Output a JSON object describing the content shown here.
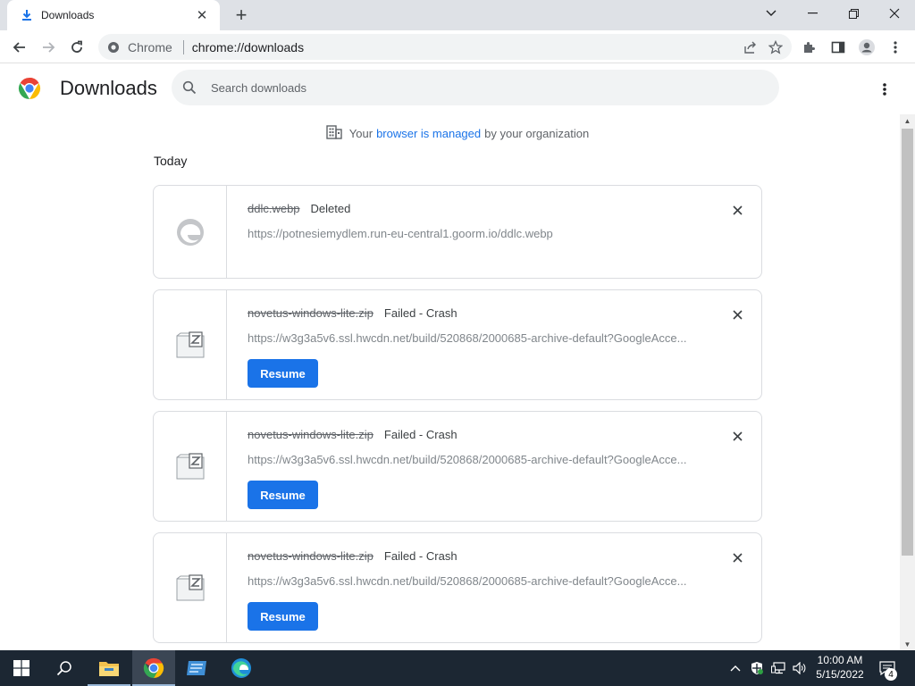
{
  "tab": {
    "title": "Downloads",
    "close": "✕"
  },
  "newtab": "+",
  "window_controls": {
    "chevron": "⌄",
    "minimize": "—",
    "maximize": "❐",
    "close": "✕"
  },
  "omnibox": {
    "site": "Chrome",
    "url": "chrome://downloads"
  },
  "page": {
    "title": "Downloads",
    "search_placeholder": "Search downloads",
    "managed_prefix": "Your",
    "managed_link": "browser is managed",
    "managed_suffix": "by your organization",
    "section_date": "Today"
  },
  "downloads": [
    {
      "name": "ddlc.webp",
      "status": "Deleted",
      "url": "https://potnesiemydlem.run-eu-central1.goorm.io/ddlc.webp",
      "icon": "edge-icon"
    },
    {
      "name": "novetus-windows-lite.zip",
      "status": "Failed - Crash",
      "url": "https://w3g3a5v6.ssl.hwcdn.net/build/520868/2000685-archive-default?GoogleAcce...",
      "resume": "Resume",
      "icon": "zip-file-icon"
    },
    {
      "name": "novetus-windows-lite.zip",
      "status": "Failed - Crash",
      "url": "https://w3g3a5v6.ssl.hwcdn.net/build/520868/2000685-archive-default?GoogleAcce...",
      "resume": "Resume",
      "icon": "zip-file-icon"
    },
    {
      "name": "novetus-windows-lite.zip",
      "status": "Failed - Crash",
      "url": "https://w3g3a5v6.ssl.hwcdn.net/build/520868/2000685-archive-default?GoogleAcce...",
      "resume": "Resume",
      "icon": "zip-file-icon"
    }
  ],
  "taskbar": {
    "time": "10:00 AM",
    "date": "5/15/2022",
    "notifications": "4"
  },
  "colors": {
    "accent": "#1a73e8",
    "taskbar": "#1c2733"
  }
}
